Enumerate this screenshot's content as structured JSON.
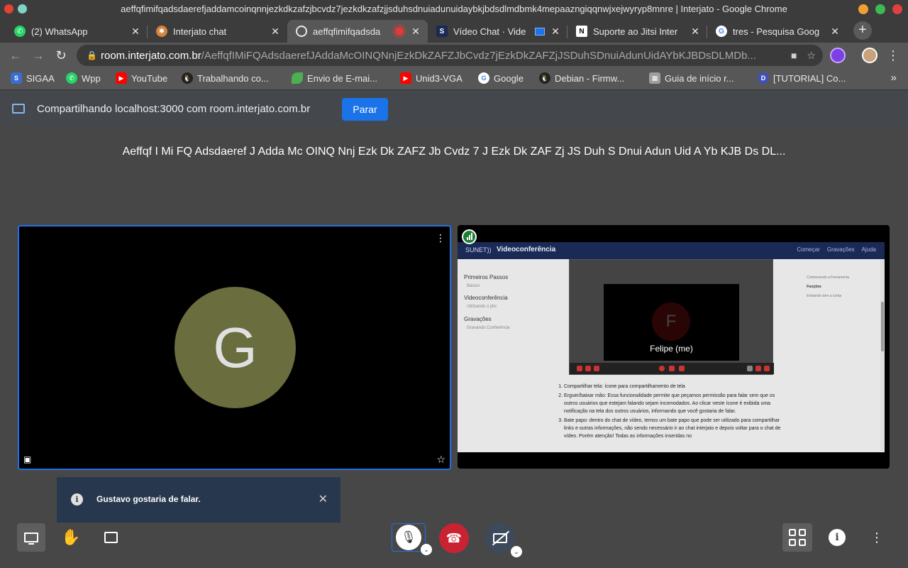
{
  "window": {
    "title": "aeffqfimifqadsdaerefjaddamcoinqnnjezkdkzafzjbcvdz7jezkdkzafzjjsduhsdnuiadunuidaybkjbdsdlmdbmk4mepaazngiqqnwjxejwyryp8mnre | Interjato - Google Chrome"
  },
  "tabs": [
    {
      "label": "(2) WhatsApp",
      "favicon": "whatsapp-icon",
      "color": "#25d366"
    },
    {
      "label": "Interjato chat",
      "favicon": "interjato-icon",
      "color": "#d4843c"
    },
    {
      "label": "aeffqfimifqadsda",
      "favicon": "globe-icon",
      "color": "#e8e8e8",
      "recording": true
    },
    {
      "label": "Vídeo Chat · Vide",
      "favicon": "sunet-icon",
      "color": "#1a73e8"
    },
    {
      "label": "Suporte ao Jitsi Inter",
      "favicon": "notion-icon",
      "color": "#ffffff"
    },
    {
      "label": "tres - Pesquisa Goog",
      "favicon": "google-icon",
      "color": "#4285f4"
    }
  ],
  "addressbar": {
    "host": "room.interjato.com.br",
    "path": "/AeffqfIMiFQAdsdaerefJAddaMcOINQNnjEzkDkZAFZJbCvdz7jEzkDkZAFZjJSDuhSDnuiAdunUidAYbKJBDsDLMDb..."
  },
  "bookmarks": [
    {
      "label": "SIGAA",
      "icon": "sigaa-icon",
      "color": "#3b6ccf"
    },
    {
      "label": "Wpp",
      "icon": "whatsapp-icon",
      "color": "#25d366"
    },
    {
      "label": "YouTube",
      "icon": "youtube-icon",
      "color": "#ff0000"
    },
    {
      "label": "Trabalhando co...",
      "icon": "linux-icon",
      "color": "#222222"
    },
    {
      "label": "Envio de E-mai...",
      "icon": "leaf-icon",
      "color": "#4caf50"
    },
    {
      "label": "Unid3-VGA",
      "icon": "youtube-icon",
      "color": "#ff0000"
    },
    {
      "label": "Google",
      "icon": "google-icon",
      "color": "#4285f4"
    },
    {
      "label": "Debian - Firmw...",
      "icon": "linux-icon",
      "color": "#222222"
    },
    {
      "label": "Guia de início r...",
      "icon": "building-icon",
      "color": "#9e9e9e"
    },
    {
      "label": "[TUTORIAL] Co...",
      "icon": "tutorial-icon",
      "color": "#3f51b5"
    }
  ],
  "sharebar": {
    "text": "Compartilhando localhost:3000 com room.interjato.com.br",
    "stop_label": "Parar"
  },
  "meeting": {
    "room_name": "Aeffqf I Mi FQ Adsdaeref J Adda Mc OINQ Nnj Ezk Dk ZAFZ Jb Cvdz 7 J Ezk Dk ZAF Zj JS Duh S Dnui Adun Uid A Yb KJB Ds DL...",
    "local_avatar_letter": "G",
    "avatar_color": "#6a6d3e"
  },
  "shared_screen": {
    "logo": "SUNET))",
    "title": "Videoconferência",
    "nav": [
      "Começar",
      "Gravações",
      "Ajuda"
    ],
    "sidebar": [
      {
        "heading": "Primeiros Passos",
        "sub": "Básico"
      },
      {
        "heading": "Videoconferência",
        "sub": "Utilizando o jitsi"
      },
      {
        "heading": "Gravações",
        "sub": "Gravando Conferência"
      }
    ],
    "right_links": [
      "Conhecendo a Ferramenta",
      "Funções",
      "Entrando sem a conta"
    ],
    "nested_avatar_letter": "F",
    "nested_name": "Felipe (me)",
    "steps": [
      "Compartilhar tela: ícone para compartilhamento de tela",
      "Erguer/baixar mão: Essa funcionalidade permite que peçamos permissão para falar sem que os outros usuários que estejam falando sejam incomodados. Ao clicar neste ícone é exibida uma notificação na tela dos outros usuários, informando que você gostaria de falar.",
      "Bate papo: dentro do chat de vídeo, temos um bate papo que pode ser utilizado para compartilhar links e outras informações, não sendo necessário ir ao chat interjato e depois voltar para o chat de vídeo. Porém atenção! Todas as informações inseridas no"
    ]
  },
  "notification": {
    "message": "Gustavo gostaria de falar."
  }
}
